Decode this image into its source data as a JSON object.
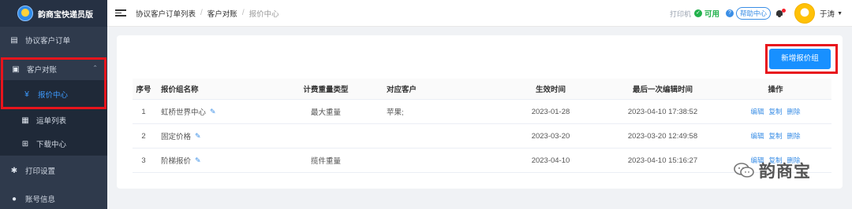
{
  "sidebar": {
    "brand": "韵商宝快递员版",
    "items": [
      {
        "label": "协议客户订单",
        "icon": "orders-icon"
      },
      {
        "label": "客户对账",
        "icon": "wallet-icon"
      },
      {
        "label": "报价中心",
        "icon": "yen-icon"
      },
      {
        "label": "运单列表",
        "icon": "document-icon"
      },
      {
        "label": "下载中心",
        "icon": "download-icon"
      },
      {
        "label": "打印设置",
        "icon": "gear-icon"
      },
      {
        "label": "账号信息",
        "icon": "user-icon"
      }
    ]
  },
  "topbar": {
    "breadcrumb": [
      "协议客户订单列表",
      "客户对账",
      "报价中心"
    ],
    "printer_label": "打印机",
    "status": "可用",
    "help": "帮助中心",
    "user": "于涛"
  },
  "main": {
    "add_button": "新增报价组",
    "columns": [
      "序号",
      "报价组名称",
      "计费重量类型",
      "对应客户",
      "生效时间",
      "最后一次编辑时间",
      "操作"
    ],
    "rows": [
      {
        "no": "1",
        "name": "虹桥世界中心",
        "weight_type": "最大重量",
        "customer": "苹果;",
        "effective": "2023-01-28",
        "last_edit": "2023-04-10 17:38:52"
      },
      {
        "no": "2",
        "name": "固定价格",
        "weight_type": "",
        "customer": "",
        "effective": "2023-03-20",
        "last_edit": "2023-03-20 12:49:58"
      },
      {
        "no": "3",
        "name": "阶梯报价",
        "weight_type": "揽件重量",
        "customer": "",
        "effective": "2023-04-10",
        "last_edit": "2023-04-10 15:16:27"
      }
    ],
    "actions": {
      "edit": "编辑",
      "copy": "复制",
      "delete": "删除"
    }
  },
  "watermark": "韵商宝",
  "colors": {
    "sidebar_bg": "#2f3a4c",
    "accent": "#1890ff",
    "highlight_box": "#e8141c",
    "ok": "#22b14c"
  }
}
